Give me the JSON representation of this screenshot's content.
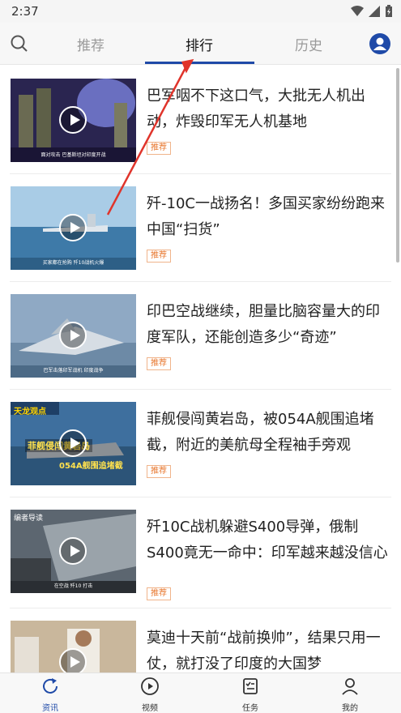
{
  "status_bar": {
    "time": "2:37"
  },
  "tabs": {
    "recommend": "推荐",
    "rank": "排行",
    "history": "历史"
  },
  "feed": {
    "items": [
      {
        "title": "巴军咽不下这口气，大批无人机出动，炸毁印军无人机基地",
        "tag": "推荐",
        "caption": "面对攻击 巴基斯坦对印度开战"
      },
      {
        "title": "歼-10C一战扬名！多国买家纷纷跑来中国“扫货”",
        "tag": "推荐",
        "caption": "买家都在抢购 歼10战机火爆"
      },
      {
        "title": "印巴空战继续，胆量比脑容量大的印度军队，还能创造多少“奇迹”",
        "tag": "推荐",
        "caption": "巴军击落印军战机 印度战争"
      },
      {
        "title": "菲舰侵闯黄岩岛，被054A舰围追堵截，附近的美航母全程袖手旁观",
        "tag": "推荐",
        "caption": "",
        "banner1": "天龙观点",
        "banner2": "菲舰侵闯黄岩岛",
        "banner3": "054A舰围追堵截"
      },
      {
        "title": "歼10C战机躲避S400导弹，俄制S400竟无一命中：印军越来越没信心",
        "tag": "推荐",
        "caption": "在空战 歼10 打击",
        "banner1": "编者导读"
      },
      {
        "title": "莫迪十天前“战前换帅”，结果只用一仗，就打没了印度的大国梦",
        "tag": "",
        "caption": ""
      }
    ]
  },
  "bottom_nav": {
    "news": "资讯",
    "video": "视频",
    "tasks": "任务",
    "mine": "我的"
  },
  "colors": {
    "accent": "#1f4aa8",
    "tag": "#e8772e",
    "annotation_arrow": "#e0342b"
  }
}
